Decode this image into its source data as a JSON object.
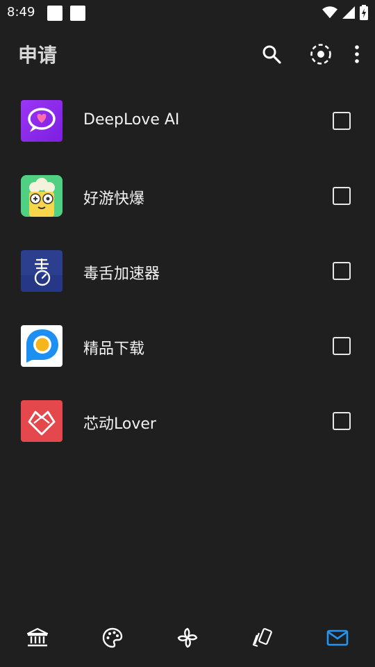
{
  "status_bar": {
    "time": "8:49",
    "icons": [
      "notification-square-icon",
      "notification-square-icon",
      "wifi-icon",
      "cell-signal-icon",
      "battery-charging-icon"
    ]
  },
  "app_bar": {
    "title": "申请",
    "actions": [
      "search-icon",
      "select-circle-icon",
      "more-vert-icon"
    ]
  },
  "apps": [
    {
      "name": "DeepLove AI",
      "icon": "chat-heart-icon",
      "checked": false
    },
    {
      "name": "好游快爆",
      "icon": "popcorn-gamepad-icon",
      "checked": false
    },
    {
      "name": "毒舌加速器",
      "icon": "speed-meter-icon",
      "checked": false
    },
    {
      "name": "精品下载",
      "icon": "p-logo-icon",
      "checked": false
    },
    {
      "name": "芯动Lover",
      "icon": "heart-outline-icon",
      "checked": false
    }
  ],
  "bottom_nav": {
    "items": [
      "bank-icon",
      "palette-icon",
      "pinwheel-icon",
      "cards-icon",
      "mail-icon"
    ],
    "active_index": 4
  },
  "colors": {
    "background": "#1f1f1f",
    "accent": "#2196f3",
    "text": "#f2f2f2"
  }
}
